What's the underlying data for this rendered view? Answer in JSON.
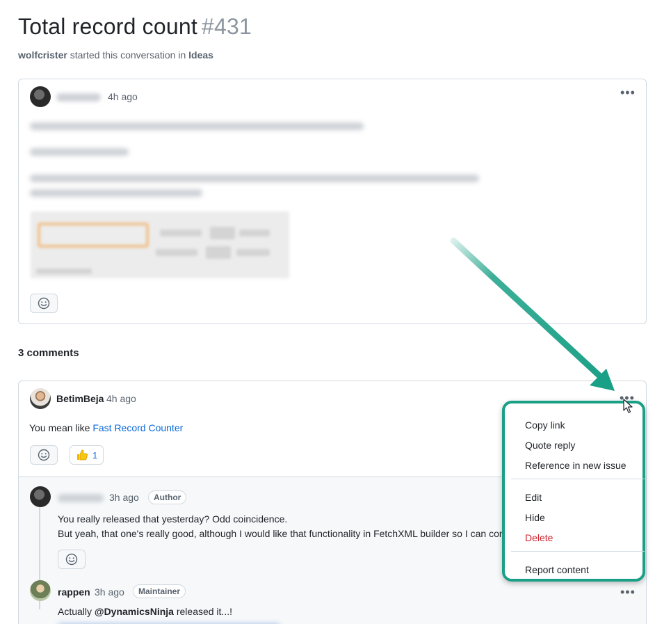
{
  "header": {
    "title": "Total record count",
    "number": "#431",
    "author": "wolfcrister",
    "started_text": "started this conversation in",
    "category": "Ideas"
  },
  "post": {
    "time": "4h ago"
  },
  "comments": {
    "count_label": "3 comments",
    "first": {
      "author": "BetimBeja",
      "time": "4h ago",
      "text_prefix": "You mean like ",
      "link_text": "Fast Record Counter",
      "reaction_count": "1"
    },
    "replies": [
      {
        "time": "3h ago",
        "badge": "Author",
        "line1": "You really released that yesterday? Odd coincidence.",
        "line2": "But yeah, that one's really good, although I would like that functionality in FetchXML builder so I can con"
      },
      {
        "author": "rappen",
        "time": "3h ago",
        "badge": "Maintainer",
        "line1_prefix": "Actually ",
        "mention": "@DynamicsNinja",
        "line1_suffix": " released it...!"
      }
    ]
  },
  "menu": {
    "items": [
      "Copy link",
      "Quote reply",
      "Reference in new issue",
      "Edit",
      "Hide",
      "Delete",
      "Report content"
    ]
  },
  "colors": {
    "accent_teal": "#1aa086",
    "link": "#0969da",
    "danger": "#cf222e"
  },
  "icons": [
    "kebab-icon",
    "smiley-icon",
    "thumbs-up-icon",
    "cursor-icon",
    "arrow-annotation"
  ]
}
